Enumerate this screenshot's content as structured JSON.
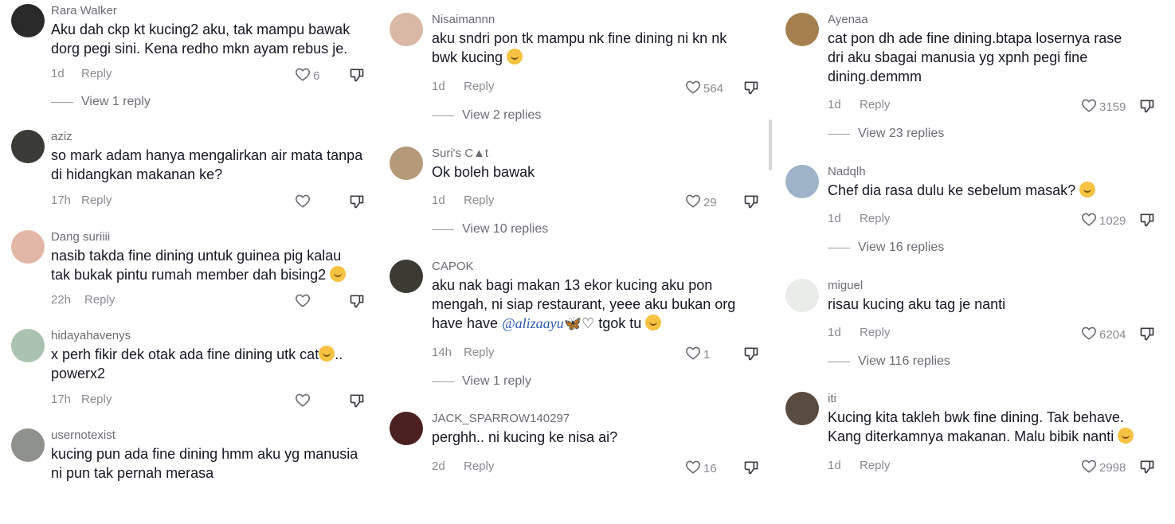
{
  "columns": [
    {
      "comments": [
        {
          "username": "Rara Walker",
          "text": "Aku dah ckp kt kucing2 aku, tak mampu bawak\ndorg pegi sini. Kena redho mkn ayam rebus je.",
          "time": "1d",
          "reply_label": "Reply",
          "likes": "6",
          "view_replies": "View 1 reply",
          "avatar_color": "#2a2a2a"
        },
        {
          "username": "aziz",
          "text": "so mark adam hanya mengalirkan air mata tanpa\ndi hidangkan makanan ke?",
          "time": "17h",
          "reply_label": "Reply",
          "likes": "",
          "view_replies": "",
          "avatar_color": "#3a3a36"
        },
        {
          "username": "Dang suriiii",
          "text": "nasib takda fine dining untuk guinea pig kalau\ntak bukak pintu rumah member dah bising2",
          "emoji": "laughing",
          "time": "22h",
          "reply_label": "Reply",
          "likes": "",
          "view_replies": "",
          "avatar_color": "#e3b7a8"
        },
        {
          "username": "hidayahavenys",
          "text": "x perh fikir dek otak ada fine dining utk cat",
          "emoji_inline": "grinning",
          "text_after": "..\npowerx2",
          "time": "17h",
          "reply_label": "Reply",
          "likes": "",
          "view_replies": "",
          "avatar_color": "#a9c3b0"
        },
        {
          "username": "usernotexist",
          "text": "kucing pun ada fine dining hmm aku yg manusia\nni pun tak pernah merasa",
          "time": "",
          "reply_label": "",
          "likes": "",
          "view_replies": "",
          "avatar_color": "#8f918c"
        }
      ]
    },
    {
      "comments": [
        {
          "username": "Nisaimannn",
          "text": "aku sndri pon tk mampu nk fine dining ni kn nk\nbwk kucing",
          "emoji": "laughing",
          "time": "1d",
          "reply_label": "Reply",
          "likes": "564",
          "view_replies": "View 2 replies",
          "avatar_color": "#d9b9a6"
        },
        {
          "username": "Suri's C▲t",
          "text": "Ok boleh bawak",
          "time": "1d",
          "reply_label": "Reply",
          "likes": "29",
          "view_replies": "View 10 replies",
          "avatar_color": "#b59a7a"
        },
        {
          "username": "CAPOK",
          "text": "aku nak bagi makan 13 ekor kucing aku pon\nmengah, ni siap restaurant, yeee aku bukan org\nhave have ",
          "mention": "@alizaayu",
          "mention_suffix": "🦋♡",
          "text_after": " tgok tu",
          "emoji": "weary",
          "time": "14h",
          "reply_label": "Reply",
          "likes": "1",
          "view_replies": "View 1 reply",
          "avatar_color": "#3b3a33"
        },
        {
          "username": "JACK_SPARROW140297",
          "text": "perghh.. ni kucing ke nisa ai?",
          "time": "2d",
          "reply_label": "Reply",
          "likes": "16",
          "view_replies": "",
          "avatar_color": "#4a2020"
        }
      ]
    },
    {
      "comments": [
        {
          "username": "Ayenaa",
          "text": "cat pon dh ade fine dining.btapa losernya rase\ndri aku sbagai manusia yg xpnh pegi fine\ndining.demmm",
          "time": "1d",
          "reply_label": "Reply",
          "likes": "3159",
          "view_replies": "View 23 replies",
          "avatar_color": "#a5804f"
        },
        {
          "username": "Nadqlh",
          "text": "Chef dia rasa dulu ke sebelum masak?",
          "emoji": "thinking",
          "time": "1d",
          "reply_label": "Reply",
          "likes": "1029",
          "view_replies": "View 16 replies",
          "avatar_color": "#9fb3c9"
        },
        {
          "username": "miguel",
          "text": "risau kucing aku tag je nanti",
          "time": "1d",
          "reply_label": "Reply",
          "likes": "6204",
          "view_replies": "View 116 replies",
          "avatar_color": "#e9ece9"
        },
        {
          "username": "iti",
          "text": "Kucing kita takleh bwk fine dining. Tak behave.\nKang diterkamnya makanan. Malu bibik nanti",
          "emoji": "pensive",
          "time": "1d",
          "reply_label": "Reply",
          "likes": "2998",
          "view_replies": "",
          "avatar_color": "#5a4b40"
        }
      ]
    }
  ],
  "icons": {
    "like": "heart-outline-icon",
    "dislike": "thumbs-down-outline-icon"
  }
}
